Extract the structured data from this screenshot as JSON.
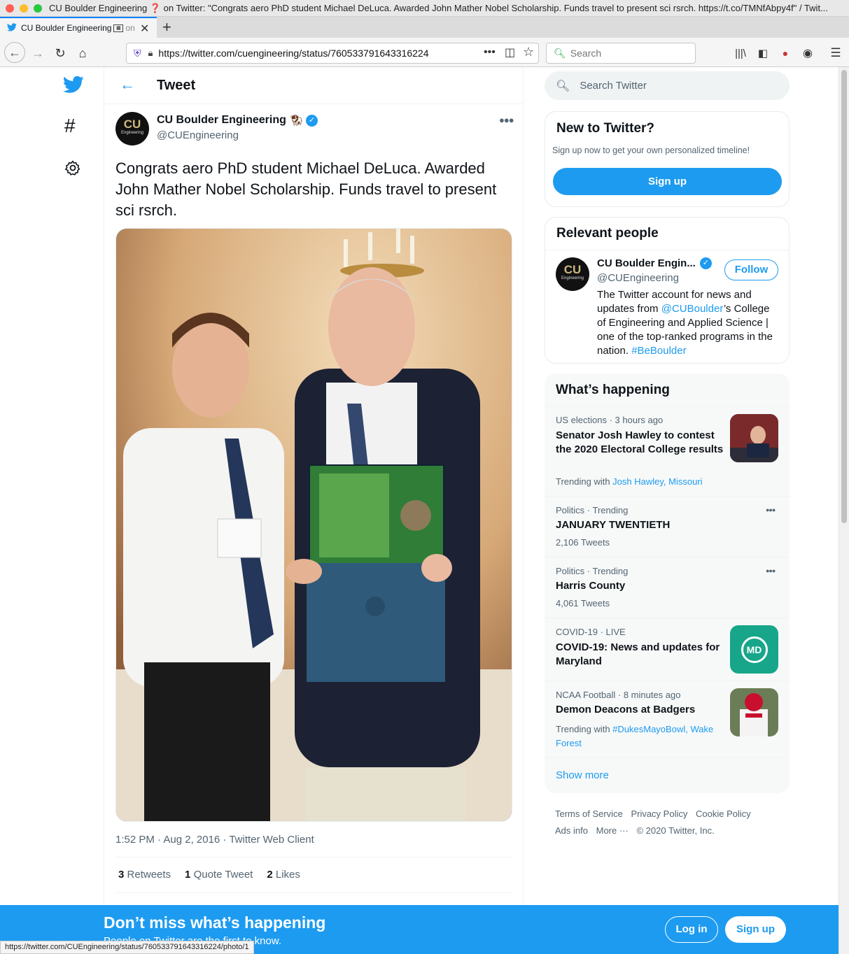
{
  "browser": {
    "window_title": "CU Boulder Engineering ❓ on Twitter: \"Congrats aero PhD student Michael DeLuca. Awarded John Mather Nobel Scholarship. Funds travel to present sci rsrch. https://t.co/TMNfAbpy4f\" / Twit...",
    "tab_title_a": "CU Boulder Engineering ",
    "tab_title_b": "on",
    "url": "https://twitter.com/cuengineering/status/760533791643316224",
    "search_placeholder": "Search",
    "status_url": "https://twitter.com/CUEngineering/status/760533791643316224/photo/1"
  },
  "header": {
    "title": "Tweet"
  },
  "tweet": {
    "author_name": "CU Boulder Engineering",
    "author_handle": "@CUEngineering",
    "avatar_text": "CU",
    "avatar_sub": "Engineering",
    "text": "Congrats aero PhD student Michael DeLuca. Awarded John Mather Nobel Scholarship. Funds travel to present sci rsrch.",
    "timestamp": "1:52 PM · Aug 2, 2016 · Twitter Web Client",
    "retweets_count": "3",
    "retweets_label": "Retweets",
    "quotes_count": "1",
    "quotes_label": "Quote Tweet",
    "likes_count": "2",
    "likes_label": "Likes"
  },
  "sidebar": {
    "search_placeholder": "Search Twitter",
    "new_title": "New to Twitter?",
    "new_sub": "Sign up now to get your own personalized timeline!",
    "signup": "Sign up",
    "relevant_title": "Relevant people",
    "person_name": "CU Boulder Engin...",
    "person_handle": "@CUEngineering",
    "follow": "Follow",
    "bio_1": "The Twitter account for news and updates from ",
    "bio_link": "@CUBoulder",
    "bio_2": "’s College of Engineering and Applied Science | one of the top-ranked programs in the nation. ",
    "bio_tag": "#BeBoulder",
    "happening_title": "What’s happening",
    "show_more": "Show more",
    "trends": [
      {
        "meta": "US elections · 3 hours ago",
        "title": "Senator Josh Hawley to contest the 2020 Electoral College results",
        "extra_label": "Trending with ",
        "extra_links": "Josh Hawley, Missouri"
      },
      {
        "meta": "Politics · Trending",
        "title": "JANUARY TWENTIETH",
        "extra": "2,106 Tweets"
      },
      {
        "meta": "Politics · Trending",
        "title": "Harris County",
        "extra": "4,061 Tweets"
      },
      {
        "meta": "COVID-19 · LIVE",
        "title": "COVID-19: News and updates for Maryland",
        "thumb_text": "MD"
      },
      {
        "meta": "NCAA Football · 8 minutes ago",
        "title": "Demon Deacons at Badgers",
        "extra_label": "Trending with ",
        "extra_links": "#DukesMayoBowl, Wake Forest"
      }
    ],
    "footer": [
      "Terms of Service",
      "Privacy Policy",
      "Cookie Policy",
      "Ads info",
      "More ···",
      "© 2020 Twitter, Inc."
    ]
  },
  "banner": {
    "title": "Don’t miss what’s happening",
    "subtitle": "People on Twitter are the first to know.",
    "login": "Log in",
    "signup": "Sign up"
  },
  "colors": {
    "accent": "#1d9bf0",
    "banner": "#1d9bf0"
  }
}
